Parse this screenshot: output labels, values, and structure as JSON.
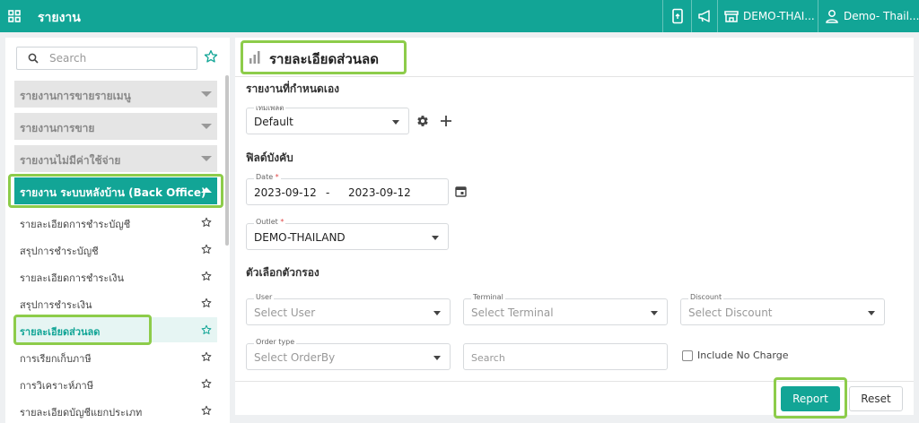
{
  "topbar": {
    "title": "รายงาน",
    "store": "DEMO-THAI...",
    "user": "Demo- Thail...",
    "icons": [
      "apps-grid-icon",
      "mobile-icon",
      "megaphone-icon",
      "store-icon",
      "user-icon"
    ]
  },
  "sidebar": {
    "search_placeholder": "Search",
    "groups": [
      {
        "label": "รายงานการขายรายเมนู",
        "expanded": false
      },
      {
        "label": "รายงานการขาย",
        "expanded": false
      },
      {
        "label": "รายงานไม่มีค่าใช้จ่าย",
        "expanded": false
      },
      {
        "label": "รายงาน ระบบหลังบ้าน (Back Office)",
        "expanded": true
      }
    ],
    "items": [
      {
        "label": "รายละเอียดการชำระบัญชี",
        "selected": false
      },
      {
        "label": "สรุปการชำระบัญชี",
        "selected": false
      },
      {
        "label": "รายละเอียดการชำระเงิน",
        "selected": false
      },
      {
        "label": "สรุปการชำระเงิน",
        "selected": false
      },
      {
        "label": "รายละเอียดส่วนลด",
        "selected": true
      },
      {
        "label": "การเรียกเก็บภาษี",
        "selected": false
      },
      {
        "label": "การวิเคราะห์ภาษี",
        "selected": false
      },
      {
        "label": "รายละเอียดบัญชีแยกประเภท",
        "selected": false
      }
    ]
  },
  "main": {
    "title": "รายละเอียดส่วนลด",
    "custom_section": "รายงานที่กำหนดเอง",
    "template": {
      "label": "เทมเพลต",
      "value": "Default"
    },
    "required_section": "ฟิลด์บังคับ",
    "date": {
      "label": "Date",
      "from": "2023-09-12",
      "sep": "-",
      "to": "2023-09-12"
    },
    "outlet": {
      "label": "Outlet",
      "value": "DEMO-THAILAND"
    },
    "filter_section": "ตัวเลือกตัวกรอง",
    "user": {
      "label": "User",
      "placeholder": "Select User"
    },
    "terminal": {
      "label": "Terminal",
      "placeholder": "Select Terminal"
    },
    "discount": {
      "label": "Discount",
      "placeholder": "Select Discount"
    },
    "order_type": {
      "label": "Order type",
      "placeholder": "Select OrderBy"
    },
    "search_placeholder": "Search",
    "include_no_charge": "Include No Charge",
    "report_button": "Report",
    "reset_button": "Reset"
  },
  "colors": {
    "accent": "#12a596",
    "highlight": "#8dcc4a"
  }
}
